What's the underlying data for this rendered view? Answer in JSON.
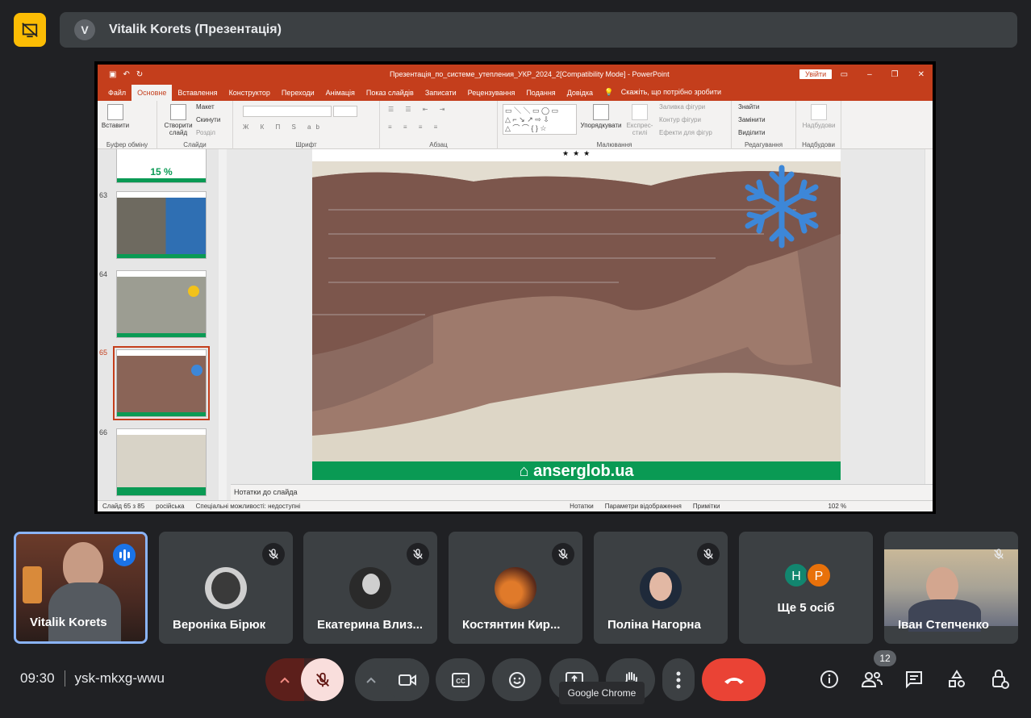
{
  "presentation": {
    "presenter_initial": "V",
    "title": "Vitalik Korets (Презентація)"
  },
  "ppt": {
    "doc_title": "Презентація_по_системе_утепления_УКР_2024_2[Compatibility Mode] - PowerPoint",
    "sign_in": "Увійти",
    "tabs": [
      "Файл",
      "Основне",
      "Вставлення",
      "Конструктор",
      "Переходи",
      "Анімація",
      "Показ слайдів",
      "Записати",
      "Рецензування",
      "Подання",
      "Довідка"
    ],
    "tell_me": "Скажіть, що потрібно зробити",
    "ribbon": {
      "paste": "Вставити",
      "cut_copy": [
        "Макет",
        "Скинути",
        "Розділ"
      ],
      "new_slide": "Створити слайд",
      "clipboard": "Буфер обміну",
      "slides": "Слайди",
      "font": "Шрифт",
      "paragraph": "Абзац",
      "arrange": "Упорядкувати",
      "quick_styles": "Експрес-стилі",
      "shape_fill": "Заливка фігури",
      "shape_outline": "Контур фігури",
      "shape_effects": "Ефекти для фігур",
      "drawing": "Малювання",
      "find": "Знайти",
      "replace": "Замінити",
      "select": "Виділити",
      "editing": "Редагування",
      "addins": "Надбудови",
      "addins_group": "Надбудови"
    },
    "thumb_prev_text": "15 %",
    "thumb_numbers": [
      "63",
      "64",
      "65",
      "66"
    ],
    "slide_footer": "anserglob.ua",
    "slide_stars": "★★★",
    "notes": "Нотатки до слайда",
    "status": {
      "slide": "Слайд 65 з 85",
      "lang": "російська",
      "access": "Спеціальні можливості: недоступні",
      "notes": "Нотатки",
      "display": "Параметри відображення",
      "comments": "Примітки",
      "zoom": "102 %"
    }
  },
  "participants": [
    {
      "name": "Vitalik Korets"
    },
    {
      "name": "Вероніка Бірюк"
    },
    {
      "name": "Екатерина Влиз..."
    },
    {
      "name": "Костянтин Кир..."
    },
    {
      "name": "Поліна Нагорна"
    },
    {
      "name": "Ще 5 осіб",
      "initials": [
        "Н",
        "Р"
      ]
    },
    {
      "name": "Іван Степченко"
    }
  ],
  "meeting": {
    "time": "09:30",
    "code": "ysk-mkxg-wwu",
    "participant_count": "12",
    "tooltip": "Google Chrome"
  },
  "colors": {
    "accent_red": "#ea4335",
    "mic_off_bg": "#f9dedc",
    "present_yellow": "#fbbc04",
    "ppt_red": "#c43e1c",
    "anserglob_green": "#0a9a54"
  }
}
